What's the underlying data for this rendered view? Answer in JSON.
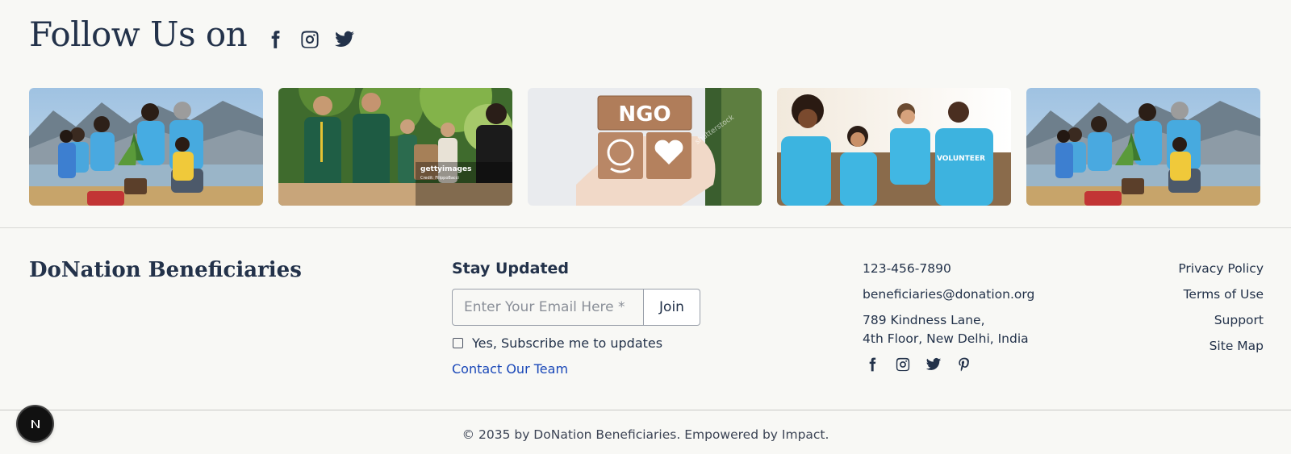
{
  "follow": {
    "title": "Follow Us on",
    "icons": [
      "facebook-icon",
      "instagram-icon",
      "twitter-icon"
    ]
  },
  "gallery": {
    "photos": [
      {
        "subject": "volunteers-with-children-planting"
      },
      {
        "subject": "volunteers-handing-food-bags",
        "watermark": "gettyimages",
        "credit": "Credit: FilippoBacci"
      },
      {
        "subject": "hand-holding-ngo-wooden-blocks",
        "block_text": "NGO",
        "watermark": "shutterstock"
      },
      {
        "subject": "volunteers-checking-phones",
        "shirt_text": "VOLUNTEER"
      },
      {
        "subject": "volunteers-with-children-planting"
      }
    ]
  },
  "footer": {
    "brand": "DoNation Beneficiaries",
    "newsletter": {
      "title": "Stay Updated",
      "email_placeholder": "Enter Your Email Here *",
      "join_label": "Join",
      "checkbox_label": "Yes, Subscribe me to updates",
      "contact_link": "Contact Our Team"
    },
    "contact": {
      "phone": "123-456-7890",
      "email": "beneficiaries@donation.org",
      "address_line1": "789 Kindness Lane,",
      "address_line2": "4th Floor, New Delhi, India",
      "icons": [
        "facebook-icon",
        "instagram-icon",
        "twitter-icon",
        "pinterest-icon"
      ]
    },
    "legal": {
      "privacy": "Privacy Policy",
      "terms": "Terms of Use",
      "support": "Support",
      "sitemap": "Site Map"
    },
    "copyright": "© 2035 by DoNation Beneficiaries. Empowered by Impact."
  },
  "colors": {
    "background": "#f8f8f5",
    "text": "#23324a",
    "link": "#1947b8",
    "volunteer_blue": "#3cb4e0"
  }
}
